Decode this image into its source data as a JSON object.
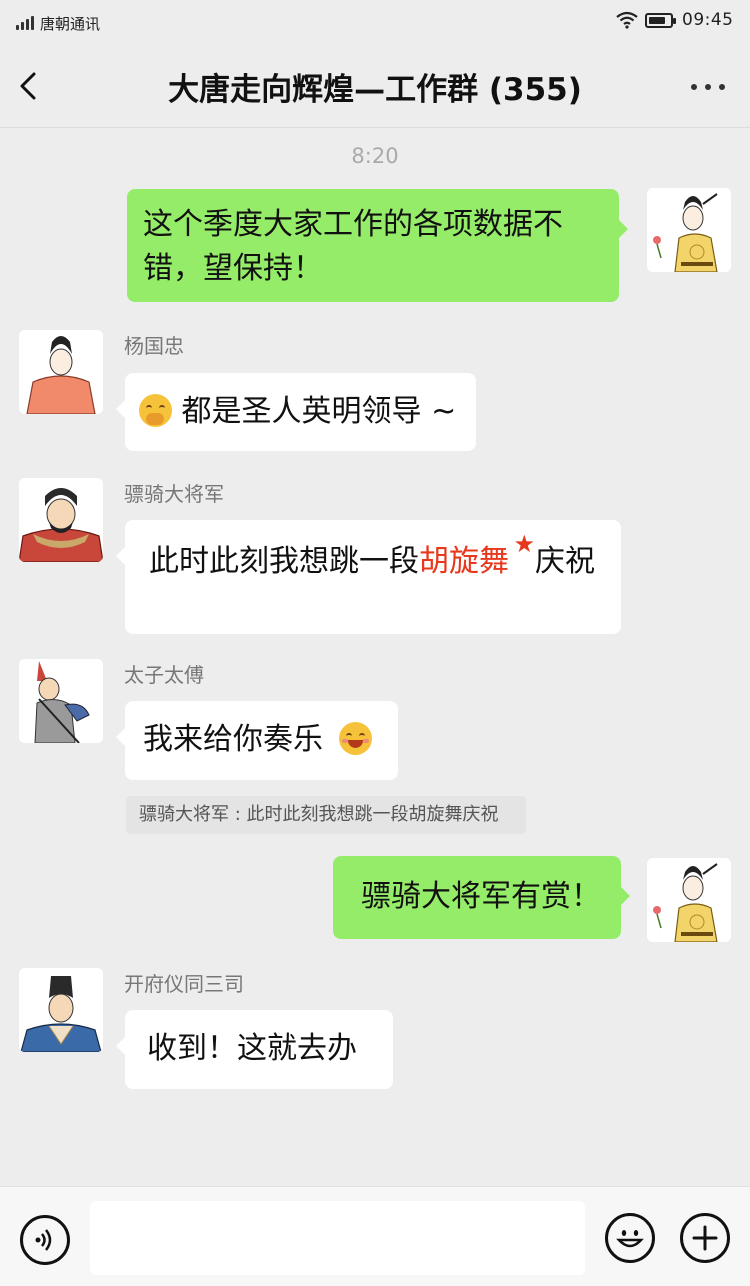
{
  "status": {
    "carrier": "唐朝通讯",
    "time": "09:45"
  },
  "chat": {
    "title": "大唐走向辉煌—工作群 (355)",
    "timestamp": "8:20"
  },
  "messages": [
    {
      "sender": "",
      "direction": "out",
      "text": "这个季度大家工作的各项数据不错，望保持！"
    },
    {
      "sender": "杨国忠",
      "direction": "in",
      "text": "都是圣人英明领导 ~",
      "emoji": "shushing-face-emoji"
    },
    {
      "sender": "骠骑大将军",
      "direction": "in",
      "text_before": "此时此刻我想跳一段",
      "highlight": "胡旋舞",
      "text_after": "庆祝",
      "highlight_color": "#e8381c"
    },
    {
      "sender": "太子太傅",
      "direction": "in",
      "text": "我来给你奏乐",
      "emoji": "grinning-face-emoji"
    },
    {
      "sender": "",
      "direction": "out",
      "text": "骠骑大将军有赏！"
    },
    {
      "sender": "开府仪同三司",
      "direction": "in",
      "text": "收到！这就去办"
    }
  ],
  "quote": {
    "text": "骠骑大将军 : 此时此刻我想跳一段胡旋舞庆祝"
  },
  "icons": {
    "back": "chevron-left-icon",
    "more": "more-dots-icon",
    "voice": "voice-input-icon",
    "emoji": "emoji-icon",
    "plus": "plus-icon"
  },
  "colors": {
    "outgoing_bubble": "#95ec69",
    "incoming_bubble": "#ffffff",
    "background": "#ededed",
    "highlight": "#e8381c"
  }
}
